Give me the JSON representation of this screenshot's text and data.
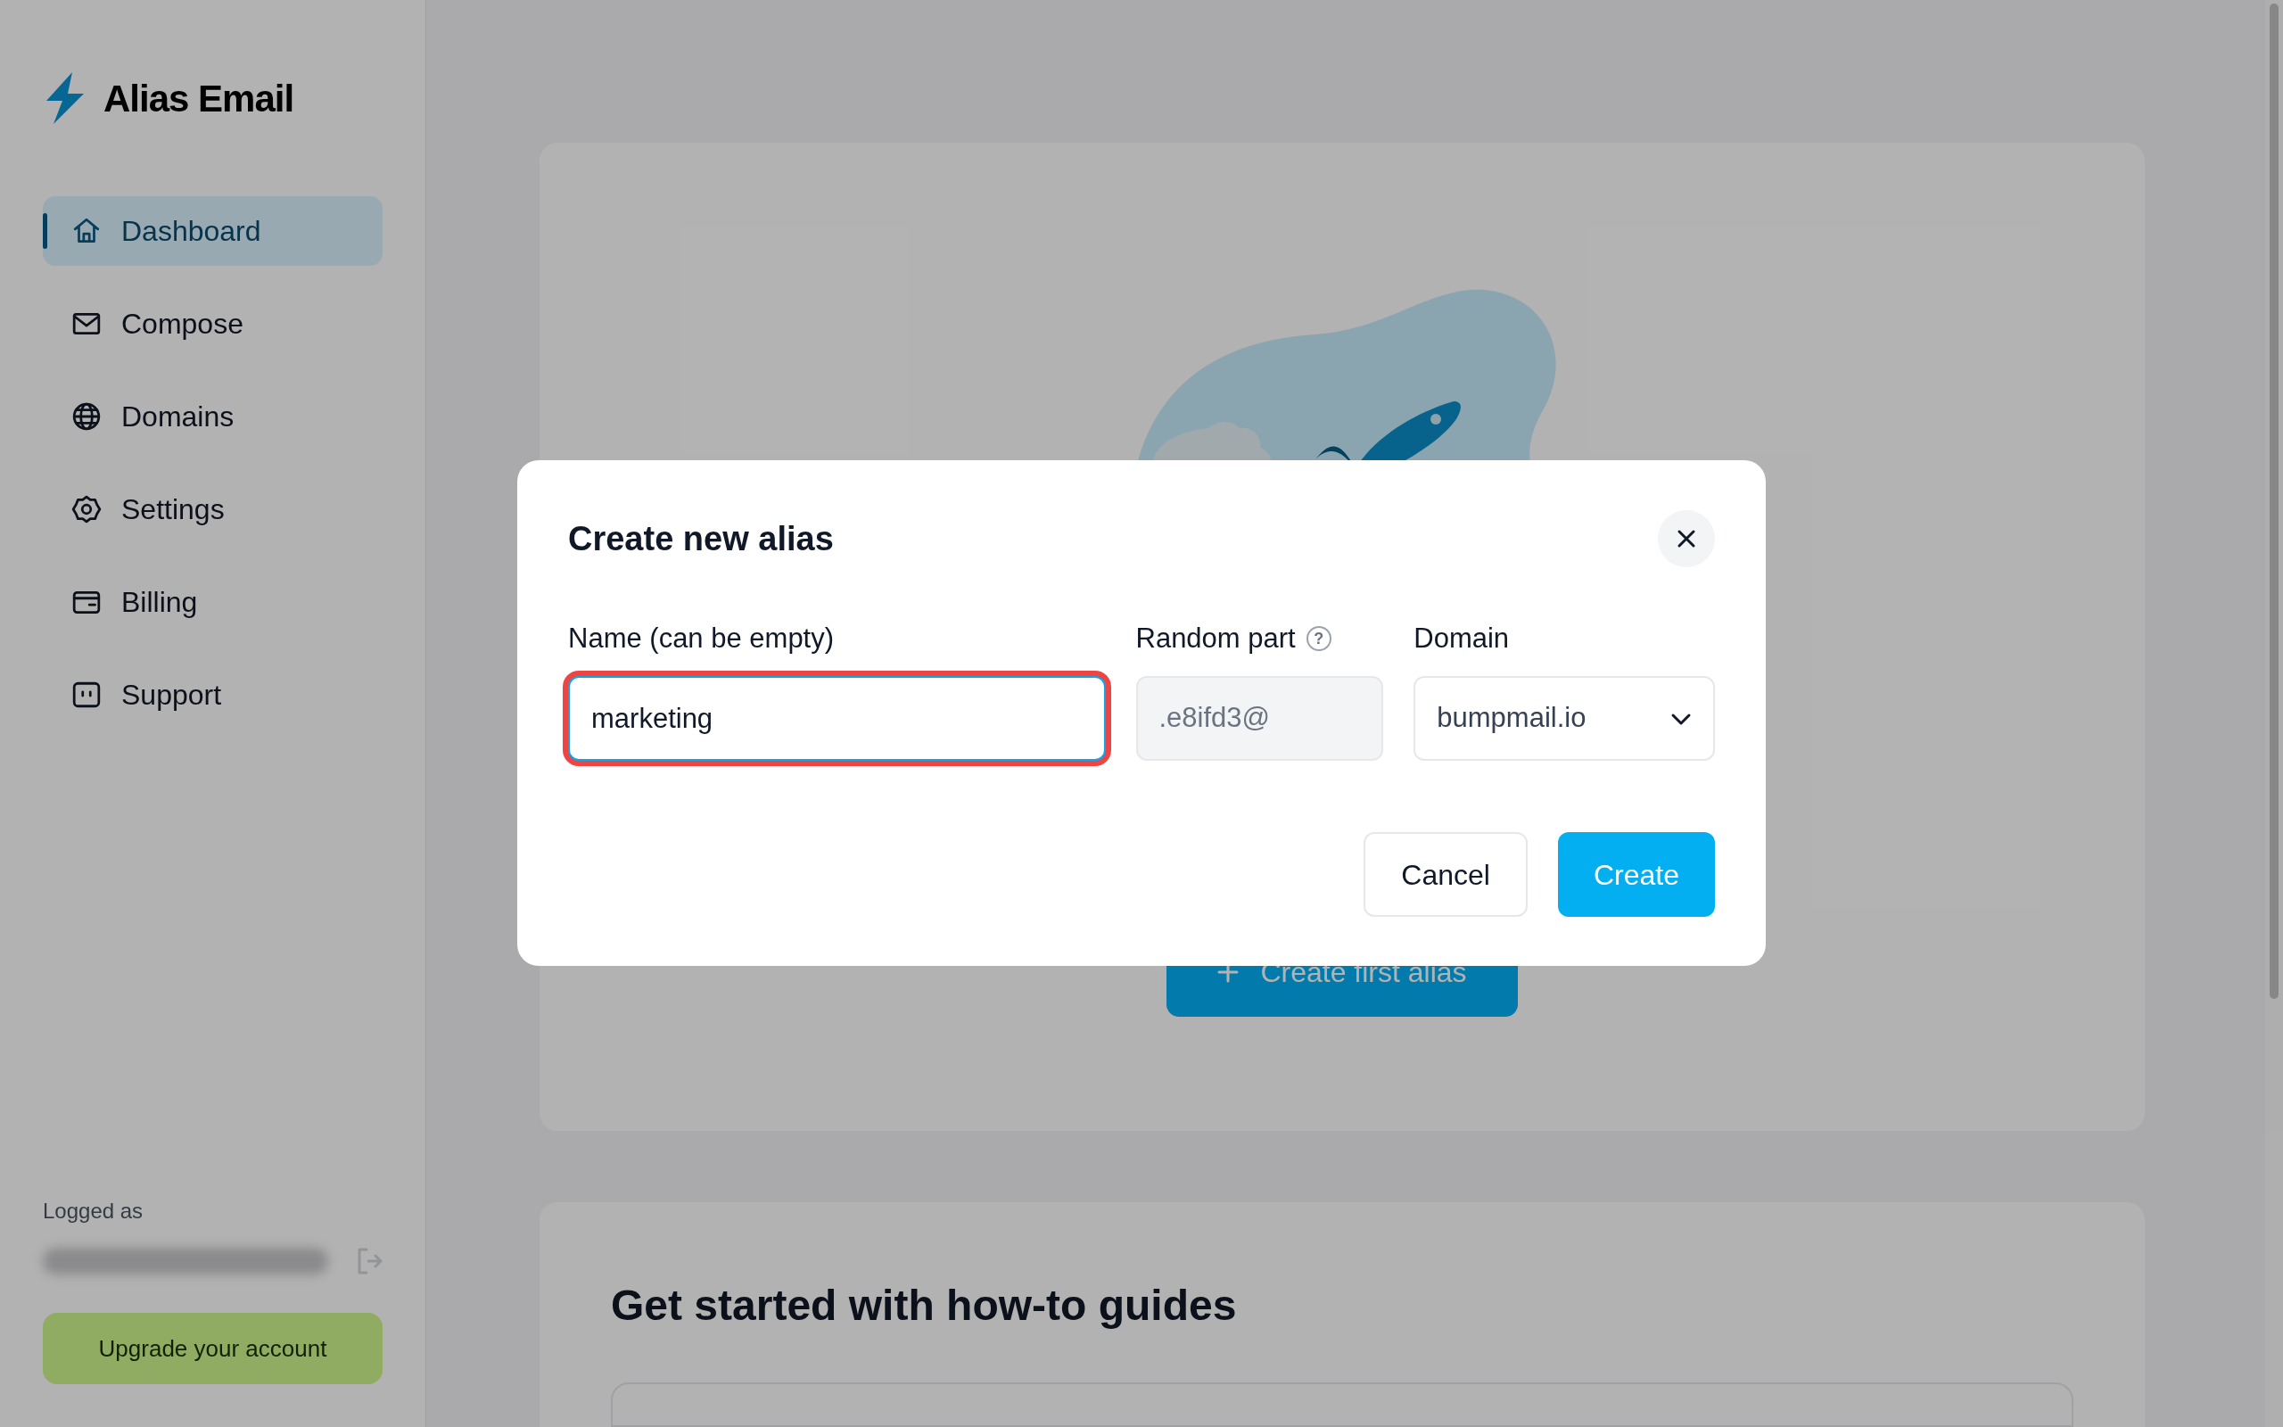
{
  "sidebar": {
    "logo": "Alias Email",
    "items": [
      {
        "label": "Dashboard",
        "selected": true
      },
      {
        "label": "Compose",
        "selected": false
      },
      {
        "label": "Domains",
        "selected": false
      },
      {
        "label": "Settings",
        "selected": false
      },
      {
        "label": "Billing",
        "selected": false
      },
      {
        "label": "Support",
        "selected": false
      }
    ],
    "logged_as_label": "Logged as",
    "upgrade_button": "Upgrade your account"
  },
  "main": {
    "hero_button": "Create first alias",
    "guides_title": "Get started with how-to guides"
  },
  "modal": {
    "title": "Create new alias",
    "fields": [
      {
        "kind": "text",
        "label": "Name (can be empty)",
        "value": "marketing",
        "focused": true
      },
      {
        "kind": "readonly",
        "label": "Random part",
        "help_icon": "?",
        "value": ".e8ifd3@",
        "focused": false
      },
      {
        "kind": "select",
        "label": "Domain",
        "value": "bumpmail.io",
        "focused": false
      }
    ],
    "buttons": [
      {
        "kind": "secondary",
        "label": "Cancel"
      },
      {
        "kind": "primary",
        "label": "Create"
      }
    ]
  }
}
